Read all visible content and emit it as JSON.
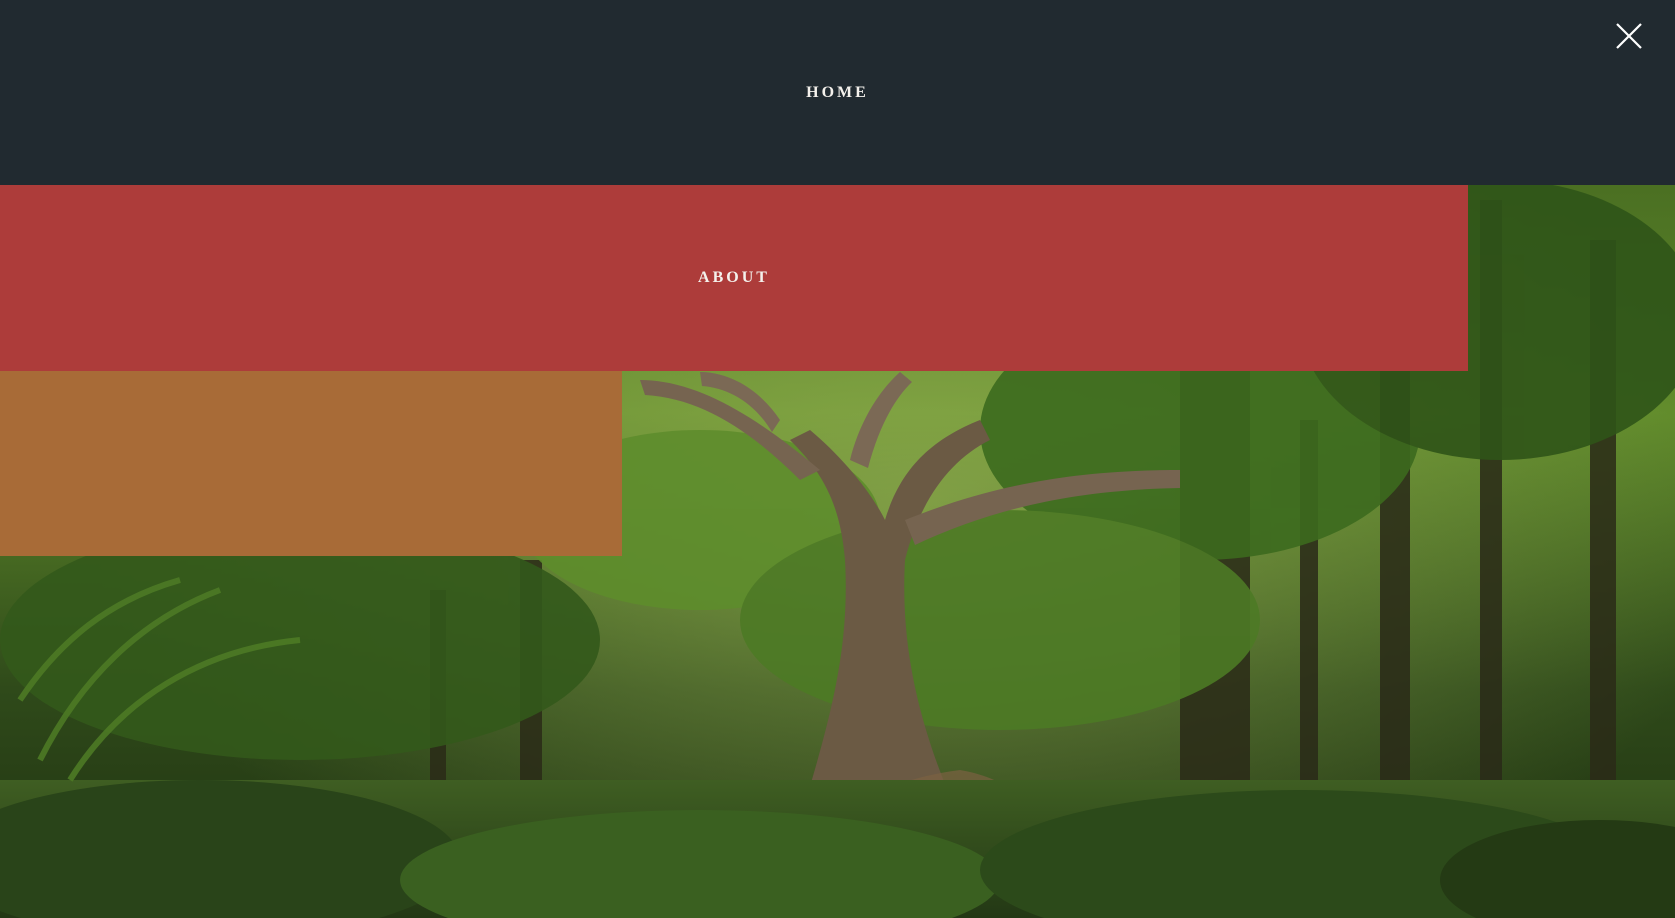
{
  "menu": {
    "items": [
      {
        "label": "HOME",
        "color": "#212a30"
      },
      {
        "label": "ABOUT",
        "color": "#ad3c3a"
      },
      {
        "label": "",
        "color": "#a86b37"
      }
    ]
  },
  "close": {
    "icon": "close-icon"
  },
  "background": {
    "subject": "forest",
    "dominant_colors": [
      "#2e4a1c",
      "#6b8c35",
      "#5a4632"
    ]
  }
}
